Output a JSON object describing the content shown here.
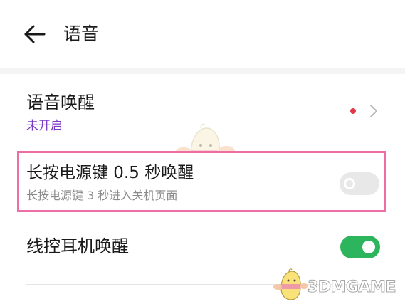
{
  "header": {
    "title": "语音",
    "back_icon": "arrow-left-icon"
  },
  "settings": {
    "voice_wake": {
      "label": "语音唤醒",
      "status": "未开启",
      "status_color": "#7a3cc4",
      "has_badge_dot": true,
      "badge_color": "#e3384a",
      "icon": "chevron-right-icon"
    },
    "power_key_wake": {
      "label": "长按电源键 0.5 秒唤醒",
      "sublabel": "长按电源键 3 秒进入关机页面",
      "enabled": false,
      "highlight_color": "#ec6ea3"
    },
    "wired_headset_wake": {
      "label": "线控耳机唤醒",
      "enabled": true,
      "on_color": "#2db55d"
    }
  },
  "watermark": {
    "text": "3DMGAME"
  }
}
